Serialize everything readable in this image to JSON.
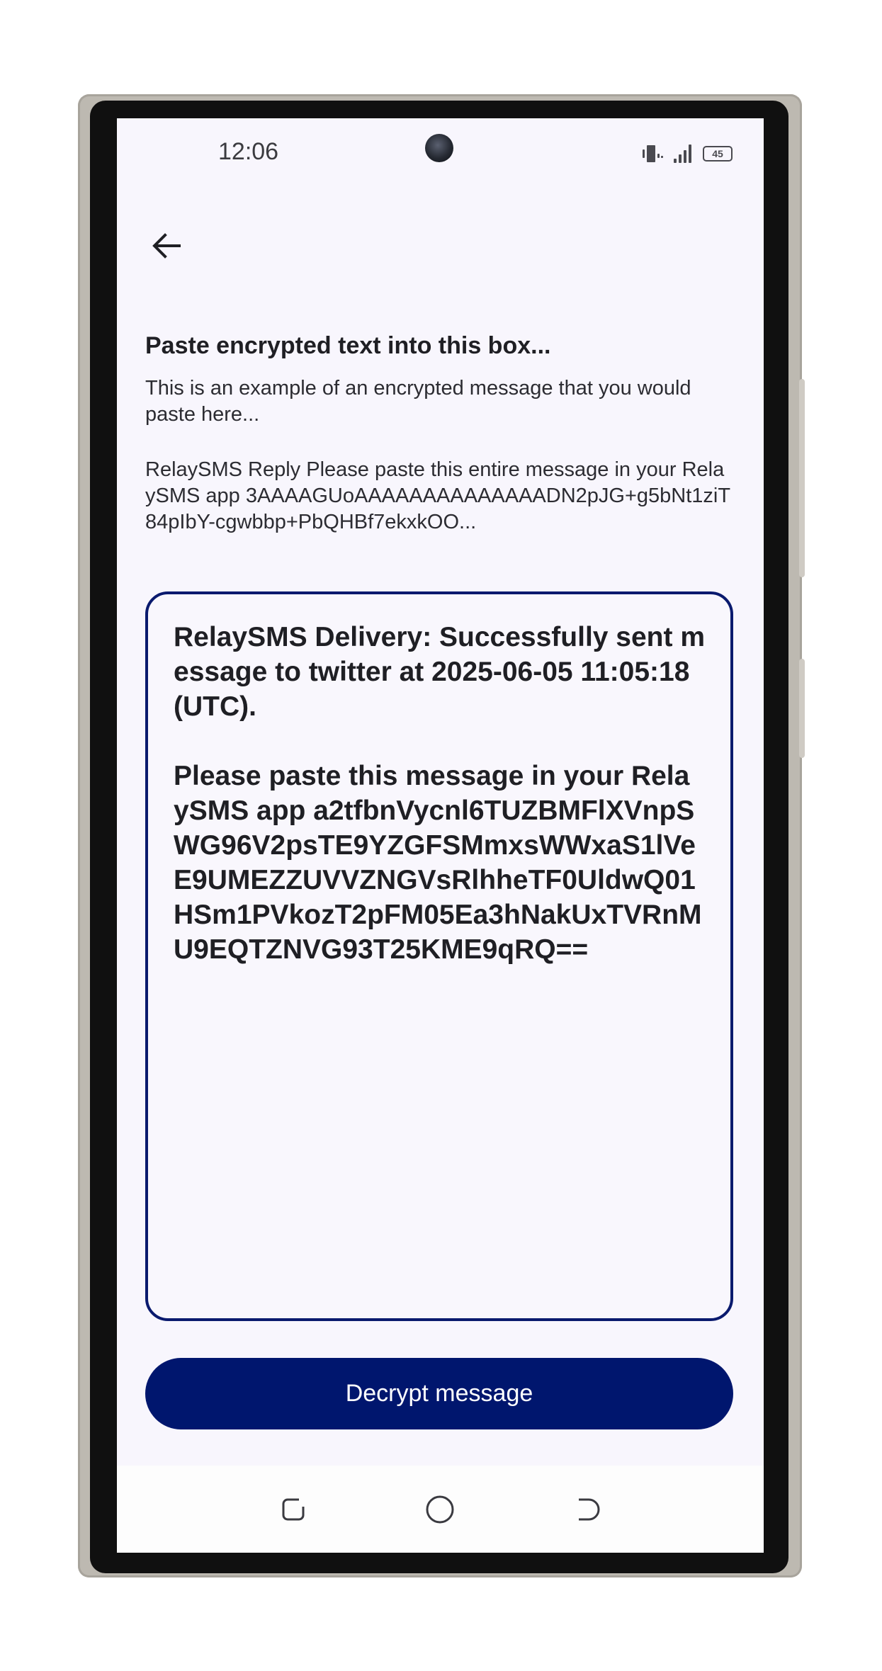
{
  "status_bar": {
    "time": "12:06",
    "battery": "45"
  },
  "icons": {
    "back": "arrow-left-icon",
    "vibrate": "vibrate-icon",
    "signal": "signal-icon",
    "battery": "battery-icon",
    "recents": "recents-icon",
    "home": "home-icon",
    "back_nav": "back-nav-icon"
  },
  "page": {
    "heading": "Paste encrypted text into this box...",
    "description": "This is an example of an encrypted message that you would paste here...",
    "example": "RelaySMS Reply Please paste this entire message in your RelaySMS app 3AAAAGUoAAAAAAAAAAAAAADN2pJG+g5bNt1ziT84pIbY-cgwbbp+PbQHBf7ekxkOO..."
  },
  "message_input": {
    "value": "RelaySMS Delivery: Successfully sent message to twitter at 2025-06-05 11:05:18 (UTC).\n\nPlease paste this message in your RelaySMS app a2tfbnVycnl6TUZBMFlXVnpSWG96V2psTE9YZGFSMmxsWWxaS1lVeE9UMEZZUVVZNGVsRlhheTF0UldwQ01HSm1PVkozT2pFM05Ea3hNakUxTVRnMU9EQTZNVG93T25KME9qRQ=="
  },
  "actions": {
    "decrypt_label": "Decrypt message"
  },
  "colors": {
    "accent": "#00166e",
    "background": "#f8f6fd"
  }
}
